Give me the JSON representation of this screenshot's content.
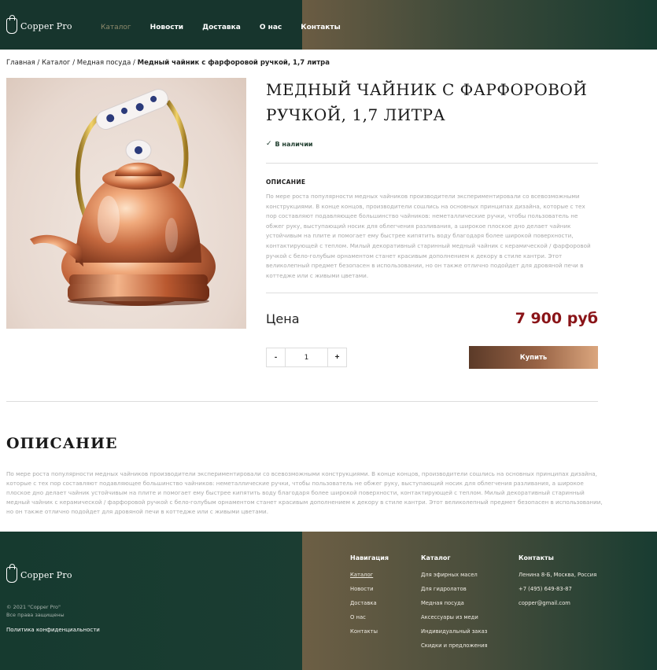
{
  "header": {
    "logo": "Copper Pro",
    "nav": [
      "Каталог",
      "Новости",
      "Доставка",
      "О нас",
      "Контакты"
    ]
  },
  "breadcrumb": {
    "items": [
      "Главная /",
      "Каталог /",
      "Медная посуда /"
    ],
    "current": "Медный чайник с фарфоровой ручкой, 1,7 литра"
  },
  "product": {
    "title": "Медный чайник с фарфоровой ручкой, 1,7 литра",
    "stock": "В наличии",
    "desc_heading": "ОПИСАНИЕ",
    "description": "По мере роста популярности медных чайников производители экспериментировали со всевозможными конструкциями. В конце концов, производители сошлись на основных принципах дизайна, которые с тех пор составляют подавляющее большинство чайников: неметаллические ручки, чтобы пользователь не обжег руку, выступающий носик для облегчения разливания, а широкое плоское дно делает чайник устойчивым на плите и помогает ему быстрее кипятить воду благодаря более широкой поверхности, контактирующей с теплом. Милый декоративный старинный медный чайник с керамической / фарфоровой ручкой с бело-голубым орнаментом станет красивым дополнением к декору в стиле кантри. Этот великолепный предмет безопасен в использовании, но он также отлично подойдет для дровяной печи в коттедже или с живыми цветами.",
    "price_label": "Цена",
    "price": "7 900 руб",
    "qty_minus": "-",
    "qty_plus": "+",
    "qty_value": "1",
    "buy": "Купить"
  },
  "section": {
    "title": "Описание",
    "text": "По мере роста популярности медных чайников производители экспериментировали со всевозможными конструкциями. В конце концов, производители сошлись на основных принципах дизайна, которые с тех пор составляют подавляющее большинство чайников: неметаллические ручки, чтобы пользователь не обжег руку, выступающий носик для облегчения разливания, а широкое плоское дно делает чайник устойчивым на плите и помогает ему быстрее кипятить воду благодаря более широкой поверхности, контактирующей с теплом. Милый декоративный старинный медный чайник с керамической / фарфоровой ручкой с бело-голубым орнаментом станет красивым дополнением к декору в стиле кантри. Этот великолепный предмет безопасен в использовании, но он также отлично подойдет для дровяной печи в коттедже или с живыми цветами."
  },
  "footer": {
    "logo": "Copper Pro",
    "copyright_1": "© 2021 \"Copper Pro\"",
    "copyright_2": "Все права защищены",
    "privacy": "Политика конфиденциальности",
    "nav_title": "Навигация",
    "nav": [
      "Каталог",
      "Новости",
      "Доставка",
      "О нас",
      "Контакты"
    ],
    "catalog_title": "Каталог",
    "catalog": [
      "Для эфирных масел",
      "Для гидролатов",
      "Медная посуда",
      "Аксессуары из меди",
      "Индивидуальный заказ",
      "Скидки и предложения"
    ],
    "contacts_title": "Контакты",
    "contacts": [
      "Ленина 8-Б, Москва, Россия",
      "+7 (495) 649-83-87",
      "copper@gmail.com"
    ]
  },
  "colors": {
    "header_dark": "#17352d",
    "price": "#8a1418",
    "buy_gradient_start": "#5b3a28",
    "buy_gradient_end": "#dba67e"
  }
}
